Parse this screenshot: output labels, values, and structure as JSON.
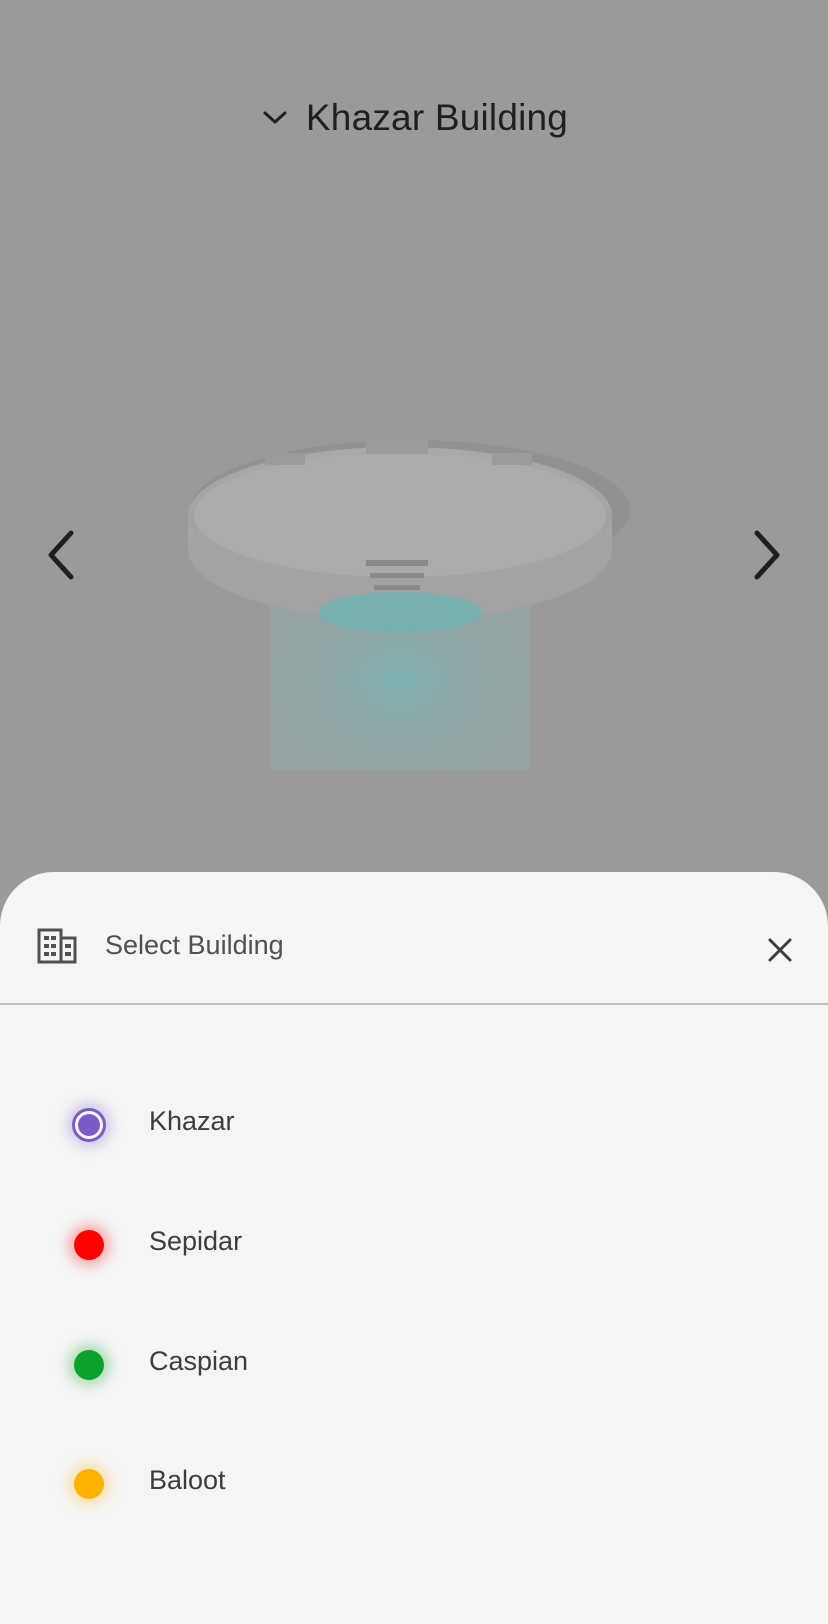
{
  "header": {
    "title": "Khazar Building"
  },
  "sheet": {
    "title": "Select Building",
    "items": [
      {
        "label": "Khazar",
        "color": "#7b5cc7",
        "selected": true
      },
      {
        "label": "Sepidar",
        "color": "#ff0000",
        "selected": false
      },
      {
        "label": "Caspian",
        "color": "#0aa22a",
        "selected": false
      },
      {
        "label": "Baloot",
        "color": "#ffb300",
        "selected": false
      }
    ]
  },
  "icons": {
    "title_dropdown": "chevron-down-icon",
    "prev": "chevron-left-icon",
    "next": "chevron-right-icon",
    "sheet_header": "building-icon",
    "close": "close-icon"
  }
}
